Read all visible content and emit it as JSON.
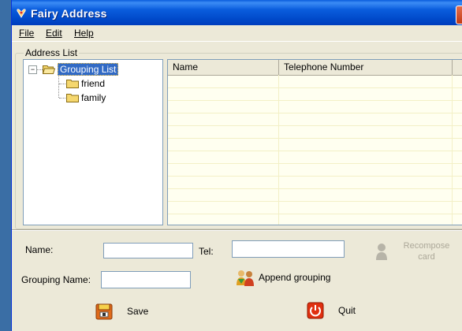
{
  "window": {
    "title": "Fairy Address",
    "close_symbol": "×"
  },
  "menu": {
    "file": "File",
    "edit": "Edit",
    "help": "Help"
  },
  "address_list": {
    "legend": "Address List",
    "tree": {
      "root": "Grouping List",
      "expander": "−",
      "children": [
        "friend",
        "family"
      ]
    },
    "table": {
      "columns": [
        "Name",
        "Telephone Number"
      ],
      "rows": []
    }
  },
  "form": {
    "name_label": "Name:",
    "name_value": "",
    "tel_label": "Tel:",
    "tel_value": "",
    "grouping_name_label": "Grouping Name:",
    "grouping_name_value": "",
    "recompose_label_1": "Recompose",
    "recompose_label_2": "card",
    "append_grouping_label": "Append grouping",
    "save_label": "Save",
    "quit_label": "Quit"
  },
  "colors": {
    "title_bar": "#0a5ddd",
    "window_bg": "#ece9d8",
    "grid_bg": "#fffff0",
    "selection": "#316ac5",
    "disabled_text": "#aca899"
  },
  "icons": {
    "title": "fairy-icon",
    "root_folder": "open-folder-icon",
    "child_folder": "folder-icon",
    "recompose": "person-silhouette-icon",
    "append": "people-icon",
    "save": "floppy-zip-icon",
    "quit": "power-icon"
  }
}
